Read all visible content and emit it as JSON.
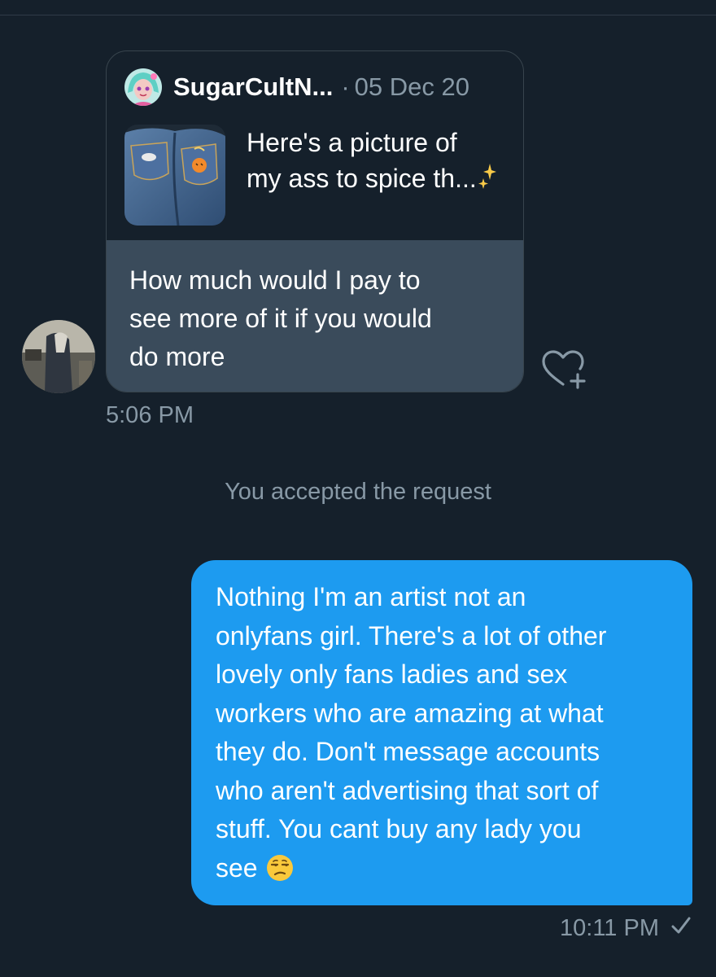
{
  "quoted_tweet": {
    "author": "SugarCultN...",
    "separator": "·",
    "date": "05 Dec 20",
    "text_lines": [
      "Here's a picture of",
      "my ass to spice th..."
    ],
    "sparkle_icon": "sparkles-icon",
    "thumbnail_icon": "photo-thumbnail"
  },
  "incoming_message": {
    "lines": [
      "How much would I pay to",
      "see more of it if you would",
      "do more"
    ],
    "time": "5:06 PM",
    "react_icon": "heart-plus-icon"
  },
  "system_message": "You accepted the request",
  "outgoing_message": {
    "lines": [
      "Nothing I'm an artist not an",
      "onlyfans girl. There's a lot of other",
      "lovely only fans ladies and sex",
      "workers who are amazing at what",
      "they do. Don't message accounts",
      "who aren't advertising that sort of",
      "stuff. You cant buy any lady you",
      "see"
    ],
    "emoji_icon": "unamused-face-icon",
    "time": "10:11 PM",
    "status_icon": "checkmark-icon"
  },
  "colors": {
    "background": "#15202b",
    "outgoing_bubble": "#1d9bf0",
    "incoming_bubble": "#3a4b5b",
    "secondary_text": "#8899a6"
  }
}
